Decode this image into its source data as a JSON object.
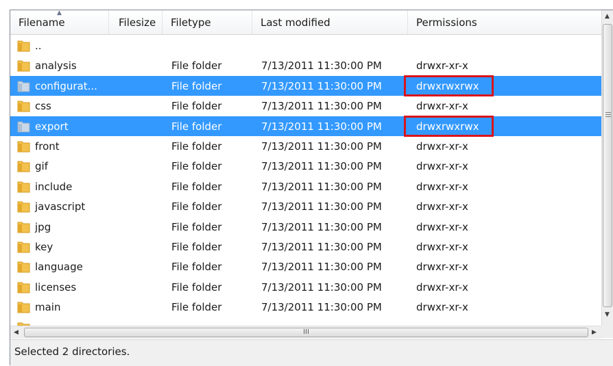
{
  "columns": {
    "filename": "Filename",
    "filesize": "Filesize",
    "filetype": "Filetype",
    "last_modified": "Last modified",
    "permissions": "Permissions"
  },
  "rows": [
    {
      "name": "..",
      "type": "",
      "modified": "",
      "perm": "",
      "selected": false
    },
    {
      "name": "analysis",
      "type": "File folder",
      "modified": "7/13/2011 11:30:00 PM",
      "perm": "drwxr-xr-x",
      "selected": false
    },
    {
      "name": "configurat...",
      "type": "File folder",
      "modified": "7/13/2011 11:30:00 PM",
      "perm": "drwxrwxrwx",
      "selected": true,
      "highlight": true
    },
    {
      "name": "css",
      "type": "File folder",
      "modified": "7/13/2011 11:30:00 PM",
      "perm": "drwxr-xr-x",
      "selected": false
    },
    {
      "name": "export",
      "type": "File folder",
      "modified": "7/13/2011 11:30:00 PM",
      "perm": "drwxrwxrwx",
      "selected": true,
      "highlight": true
    },
    {
      "name": "front",
      "type": "File folder",
      "modified": "7/13/2011 11:30:00 PM",
      "perm": "drwxr-xr-x",
      "selected": false
    },
    {
      "name": "gif",
      "type": "File folder",
      "modified": "7/13/2011 11:30:00 PM",
      "perm": "drwxr-xr-x",
      "selected": false
    },
    {
      "name": "include",
      "type": "File folder",
      "modified": "7/13/2011 11:30:00 PM",
      "perm": "drwxr-xr-x",
      "selected": false
    },
    {
      "name": "javascript",
      "type": "File folder",
      "modified": "7/13/2011 11:30:00 PM",
      "perm": "drwxr-xr-x",
      "selected": false
    },
    {
      "name": "jpg",
      "type": "File folder",
      "modified": "7/13/2011 11:30:00 PM",
      "perm": "drwxr-xr-x",
      "selected": false
    },
    {
      "name": "key",
      "type": "File folder",
      "modified": "7/13/2011 11:30:00 PM",
      "perm": "drwxr-xr-x",
      "selected": false
    },
    {
      "name": "language",
      "type": "File folder",
      "modified": "7/13/2011 11:30:00 PM",
      "perm": "drwxr-xr-x",
      "selected": false
    },
    {
      "name": "licenses",
      "type": "File folder",
      "modified": "7/13/2011 11:30:00 PM",
      "perm": "drwxr-xr-x",
      "selected": false
    },
    {
      "name": "main",
      "type": "File folder",
      "modified": "7/13/2011 11:30:00 PM",
      "perm": "drwxr-xr-x",
      "selected": false
    },
    {
      "name": "",
      "type": "",
      "modified": "",
      "perm": "",
      "selected": false
    }
  ],
  "scrollbar": {
    "horizontal_grip": "III"
  },
  "status": {
    "text": "Selected 2 directories."
  },
  "icons": {
    "folder": "folder-icon",
    "sort": "sort-ascending-icon"
  },
  "colors": {
    "selection": "#3399ff",
    "highlight_box": "#d9141b",
    "folder": "#f2c14e"
  }
}
